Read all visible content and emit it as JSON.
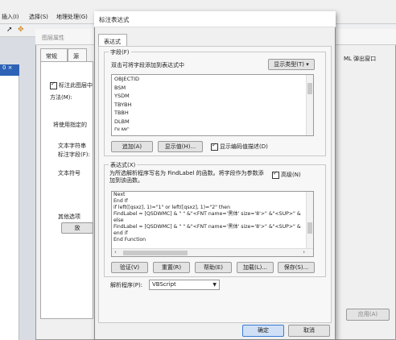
{
  "app": {
    "menu": [
      "插入(I)",
      "选择(S)",
      "地理处理(G)"
    ],
    "left_panel_label": "0 ×",
    "right_label": "ML 弹出窗口"
  },
  "layer_props": {
    "title": "图层属性",
    "tabs": [
      "常规",
      "源"
    ],
    "label_checkbox": "标注此图层中",
    "method_label": "方法(M):",
    "use_text": "将使用指定的",
    "text_string_label": "文本字符串",
    "label_field_label": "标注字段(F):",
    "text_symbol_label": "文本符号",
    "other_options_label": "其他选项",
    "other_btn": "放",
    "apply_button": "应用(A)"
  },
  "dialog": {
    "title": "标注表达式",
    "tab": "表达式",
    "fields_group": "字段(F)",
    "fields_hint": "双击可将字段添加到表达式中",
    "show_type_button": "显示类型(T) ▾",
    "fields": [
      "OBJECTID",
      "BSM",
      "YSDM",
      "TBYBH",
      "TBBH",
      "DLBM",
      "DLMC"
    ],
    "append_button": "追加(A)",
    "show_values_button": "显示值(H)...",
    "show_coded_desc": "显示编码值描述(D)",
    "expr_group": "表达式(X)",
    "expr_desc": "为所选解析程序写名为 FindLabel 的函数。将字段作为参数添加到该函数。",
    "advanced_label": "高级(N)",
    "code_lines": [
      "    Next",
      "  End If",
      "if left([qsxz], 1)=\"1\" or left([qsxz], 1)=\"2\"  then",
      "FindLabel = [QSDWMC] & \" \" &\"<FNT name='黑体' size='8'>\" &\"<SUP>\" &",
      "else",
      "FindLabel = [QSDWMC] & \" \" &\"<FNT name='黑体' size='8'>\" &\"<SUP>\" &",
      "end if",
      "End Function"
    ],
    "verify_button": "验证(V)",
    "reset_button": "重置(R)",
    "help_button": "帮助(E)",
    "load_button": "加载(L)...",
    "save_button": "保存(S)...",
    "parser_label": "解析程序(P):",
    "parser_value": "VBScript",
    "ok_button": "确定",
    "cancel_button": "取消"
  }
}
